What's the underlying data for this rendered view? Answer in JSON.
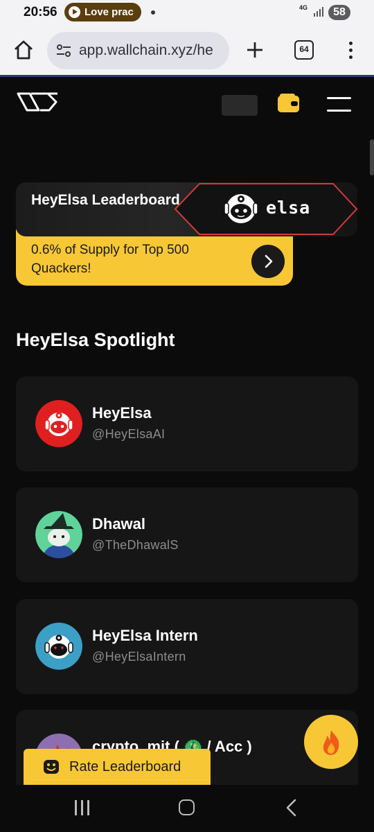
{
  "status_bar": {
    "time": "20:56",
    "notification": "Love prac",
    "network": "4G",
    "battery": "58"
  },
  "browser": {
    "url": "app.wallchain.xyz/he",
    "tab_count": "64"
  },
  "leaderboard_banner": {
    "title": "HeyElsa Leaderboard",
    "badge_text": "elsa",
    "subtitle": "0.6% of Supply for Top 500 Quackers!"
  },
  "spotlight": {
    "title": "HeyElsa Spotlight",
    "items": [
      {
        "name": "HeyElsa",
        "handle": "@HeyElsaAI"
      },
      {
        "name": "Dhawal",
        "handle": "@TheDhawalS"
      },
      {
        "name": "HeyElsa Intern",
        "handle": "@HeyElsaIntern"
      },
      {
        "name": "crypto_mit ( 🦚 / Acc )",
        "handle": ""
      }
    ]
  },
  "rate_button": {
    "label": "Rate Leaderboard"
  },
  "colors": {
    "accent": "#f7c736",
    "background": "#0b0b0b",
    "card": "#161616"
  }
}
